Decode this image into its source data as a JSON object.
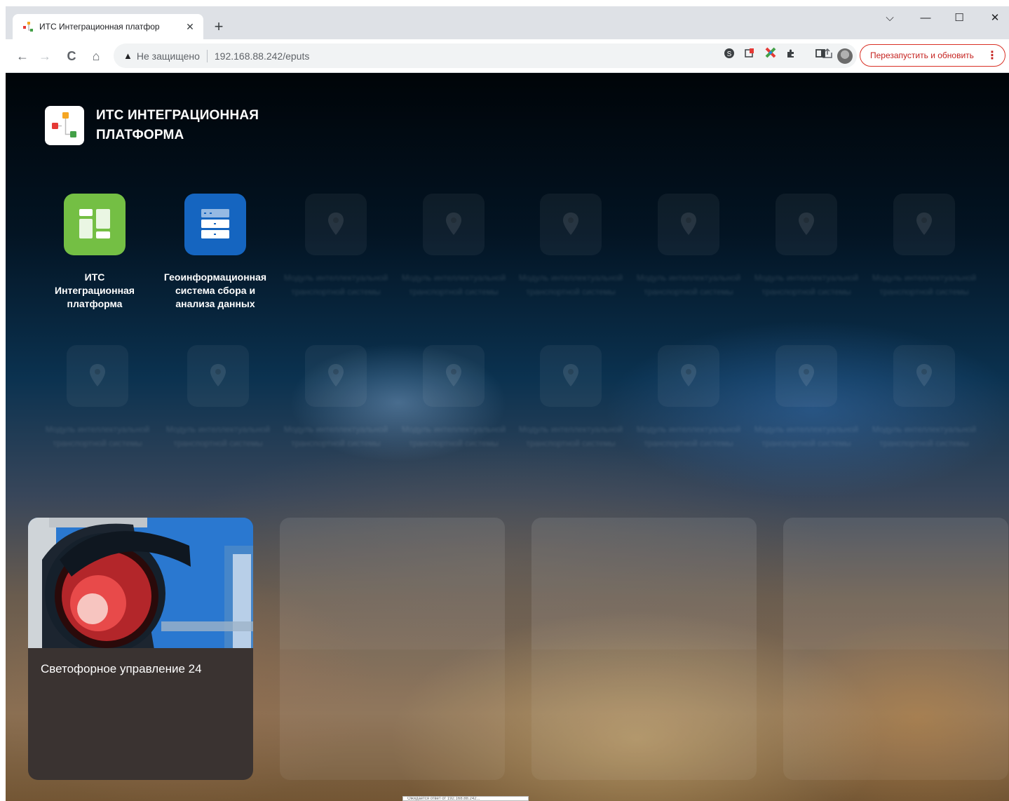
{
  "browser": {
    "tab_title": "ИТС Интеграционная платфор",
    "tab_close": "✕",
    "new_tab": "+",
    "window_controls": {
      "dropdown": "⌵",
      "minimize": "—",
      "maximize": "☐",
      "close": "✕"
    },
    "nav": {
      "back": "←",
      "forward": "→",
      "reload": "C",
      "home": "⌂"
    },
    "security_icon": "▲",
    "security_text": "Не защищено",
    "url": "192.168.88.242/eputs",
    "relaunch_button": "Перезапустить и обновить",
    "menu_dots": "⋮"
  },
  "brand": {
    "line1": "ИТС ИНТЕГРАЦИОННАЯ",
    "line2": "ПЛАТФОРМА"
  },
  "apps": [
    {
      "label_lines": [
        "ИТС",
        "Интеграционная",
        "платформа"
      ],
      "color": "#74bf44",
      "icon": "dashboard-icon"
    },
    {
      "label_lines": [
        "Геоинформационная",
        "система сбора и",
        "анализа данных"
      ],
      "color": "#1565c0",
      "icon": "server-icon"
    }
  ],
  "ghost_app_label": "Модуль интеллектуальной транспортной системы",
  "cards": [
    {
      "title": "Светофорное управление 24"
    }
  ],
  "status_bubble": "Ожидается ответ от 192.168.88.242..."
}
